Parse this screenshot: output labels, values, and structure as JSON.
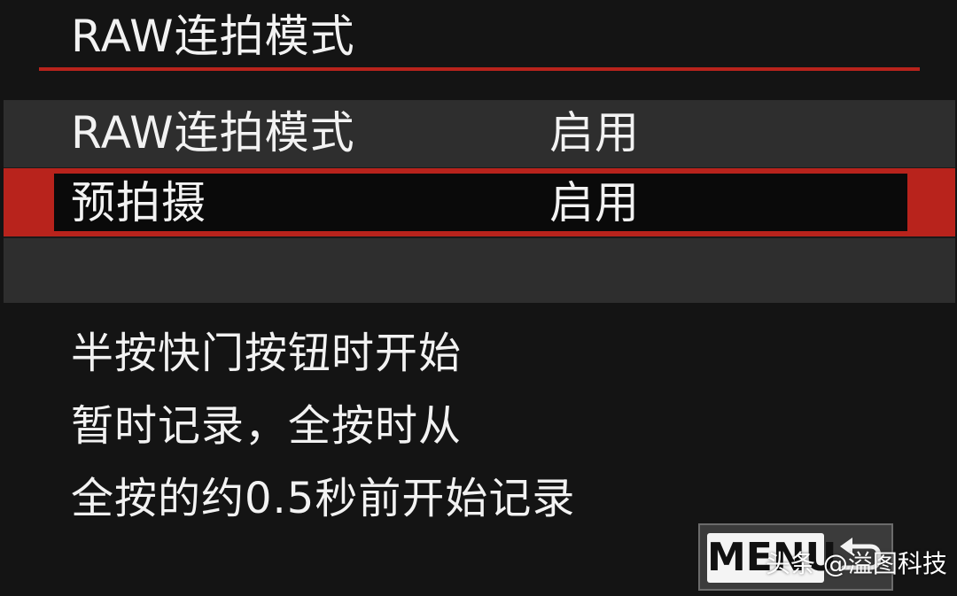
{
  "header": {
    "title": "RAW连拍模式"
  },
  "menu": {
    "items": [
      {
        "label": "RAW连拍模式",
        "value": "启用",
        "selected": false
      },
      {
        "label": "预拍摄",
        "value": "启用",
        "selected": true
      },
      {
        "label": "",
        "value": "",
        "selected": false
      }
    ]
  },
  "description": {
    "lines": [
      "半按快门按钮时开始",
      "暂时记录，全按时从",
      "全按的约0.5秒前开始记录"
    ]
  },
  "footer": {
    "menu_key_label": "MENU",
    "back_icon": "return-arrow-icon"
  },
  "watermark": {
    "text": "头条 @溢图科技"
  },
  "colors": {
    "accent": "#b8231c",
    "background": "#141414",
    "list_background": "#2e2e2e",
    "selected_inner": "#0a0a0a"
  }
}
